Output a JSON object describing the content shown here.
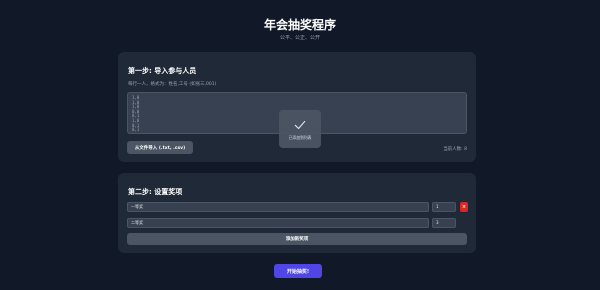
{
  "header": {
    "title": "年会抽奖程序",
    "subtitle": "公平、公正、公开"
  },
  "step1": {
    "title": "第一步: 导入参与人员",
    "hint": "每行一人，格式为：姓名,工号 (如张三,001)",
    "textarea_lines": [
      "1,0",
      "1,0",
      "1,0",
      "0,0",
      "0,1",
      "1,0",
      "0,1",
      "0,1"
    ],
    "import_button": "从文件导入 (.txt, .csv)",
    "count_label": "当前人数: 8"
  },
  "toast": {
    "icon": "check-icon",
    "text": "已添加到列表"
  },
  "step2": {
    "title": "第二步: 设置奖项",
    "prizes": [
      {
        "name": "一等奖",
        "quantity": "1",
        "delete_label": "×"
      },
      {
        "name": "二等奖",
        "quantity": "3",
        "delete_label": ""
      }
    ],
    "add_button": "添加新奖项"
  },
  "start_button": "开始抽奖!",
  "colors": {
    "background": "#111827",
    "card": "#1f2937",
    "input": "#374151",
    "button": "#4b5563",
    "primary": "#4f46e5",
    "danger": "#dc2626"
  }
}
